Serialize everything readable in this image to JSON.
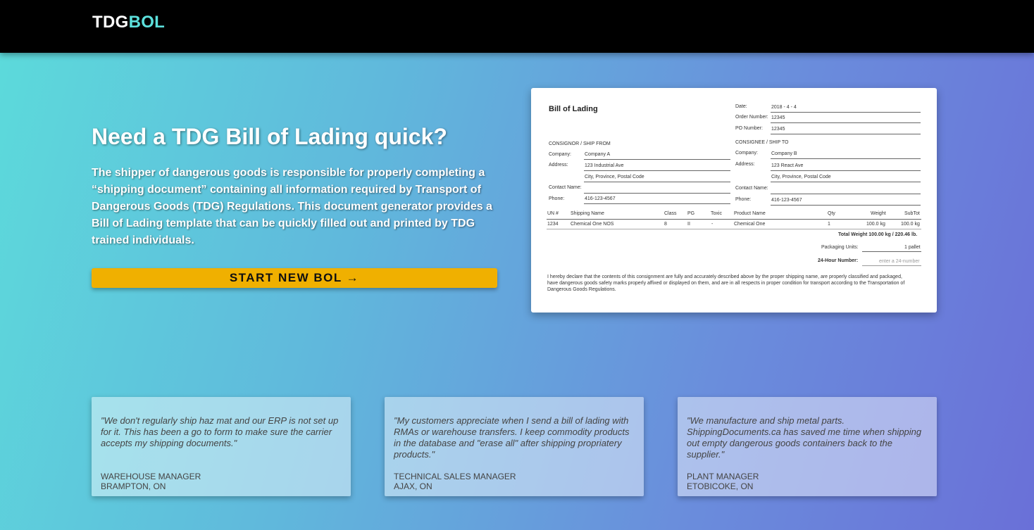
{
  "header": {
    "logo_part1": "TDG",
    "logo_part2": "BOL"
  },
  "hero": {
    "title": "Need a TDG Bill of Lading quick?",
    "text": "The shipper of dangerous goods is responsible for properly completing a “shipping document” containing all information required by Transport of Dangerous Goods (TDG) Regulations. This document generator provides a Bill of Lading template that can be quickly filled out and printed by TDG trained individuals.",
    "cta_label": "START NEW BOL →"
  },
  "preview": {
    "title": "Bill of Lading",
    "date_label": "Date:",
    "date_value": "2018 - 4 - 4",
    "order_label": "Order Number:",
    "order_value": "12345",
    "po_label": "PO Number:",
    "po_value": "12345",
    "consignor_heading": "CONSIGNOR / SHIP FROM",
    "consignee_heading": "CONSIGNEE / SHIP TO",
    "company_label": "Company:",
    "address_label": "Address:",
    "contact_label": "Contact Name:",
    "phone_label": "Phone:",
    "consignor": {
      "company": "Company A",
      "address1": "123 Industrial Ave",
      "address2": "City, Province, Postal Code",
      "contact": "",
      "phone": "416-123-4567"
    },
    "consignee": {
      "company": "Company B",
      "address1": "123 React Ave",
      "address2": "City, Province, Postal Code",
      "contact": "",
      "phone": "416-123-4567"
    },
    "table_headers": [
      "UN #",
      "Shipping Name",
      "Class",
      "PG",
      "Toxic",
      "Product Name",
      "Qty",
      "Weight",
      "SubTot"
    ],
    "row": [
      "1234",
      "Chemical One NOS",
      "8",
      "II",
      "-",
      "Chemical One",
      "1",
      "100.0 kg",
      "100.0 kg"
    ],
    "total_weight": "Total Weight 100.00 kg / 220.46 lb.",
    "packaging_label": "Packaging Units:",
    "packaging_value": "1 pallet",
    "emergency_label": "24-Hour Number:",
    "emergency_placeholder": "enter a 24-number",
    "declaration": [
      "I hereby declare that the contents of this consignment are fully and accurately described above by the proper shipping name, are properly classified and packaged,",
      "have dangerous goods safety marks properly affixed or displayed on them, and are in all respects in proper condition for transport according to the Transportation of",
      "Dangerous Goods Regulations."
    ]
  },
  "testimonials": [
    {
      "quote": "\"We don't regularly ship haz mat and our ERP is not set up for it. This has been a go to form to make sure the carrier accepts my shipping documents.\"",
      "role": "WAREHOUSE MANAGER",
      "location": "BRAMPTON, ON"
    },
    {
      "quote": "\"My customers appreciate when I send a bill of lading with RMAs or warehouse transfers. I keep commodity products in the database and \"erase all\" after shipping propriatery products.\"",
      "role": "TECHNICAL SALES MANAGER",
      "location": "AJAX, ON"
    },
    {
      "quote": "\"We manufacture and ship metal parts. ShippingDocuments.ca has saved me time when shipping out empty dangerous goods containers back to the supplier.\"",
      "role": "PLANT MANAGER",
      "location": "ETOBICOKE, ON"
    }
  ]
}
